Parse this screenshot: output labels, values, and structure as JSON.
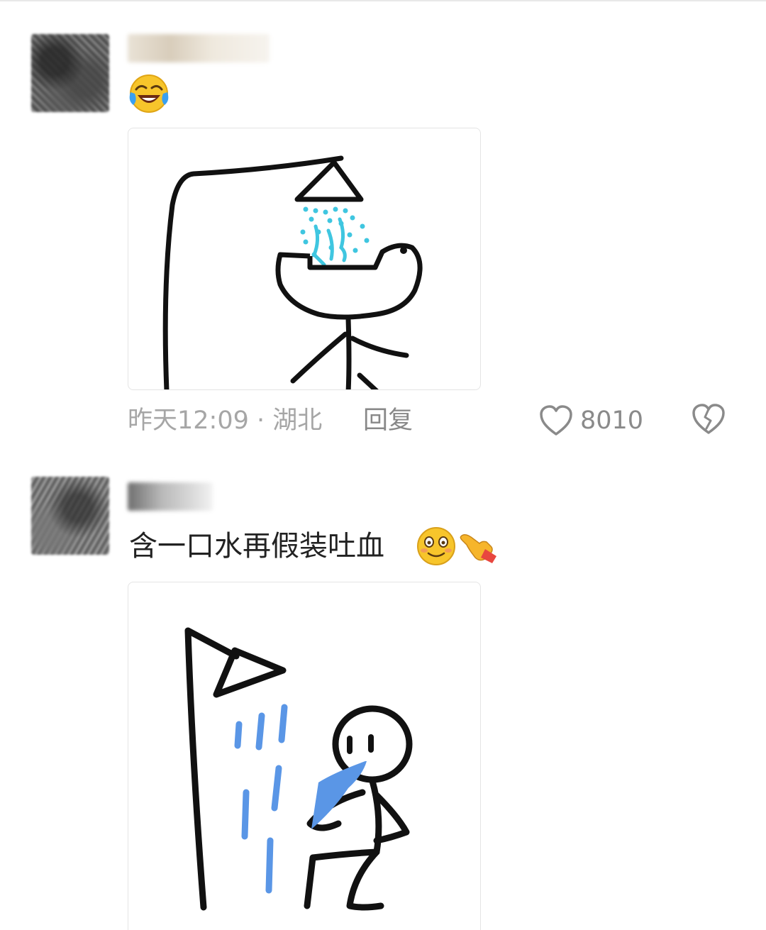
{
  "comments": [
    {
      "text_emoji": "laughing-crying-emoji",
      "timestamp": "昨天12:09",
      "separator": " · ",
      "location": "湖北",
      "reply_label": "回复",
      "like_count": "8010"
    },
    {
      "text": "含一口水再假装吐血",
      "trailing_emojis": [
        "smiling-emoji",
        "pointing-hand-emoji"
      ]
    }
  ],
  "colors": {
    "meta_text": "#a6a6a6",
    "water_light": "#3fc6e0",
    "water_blue": "#5a96e6"
  }
}
